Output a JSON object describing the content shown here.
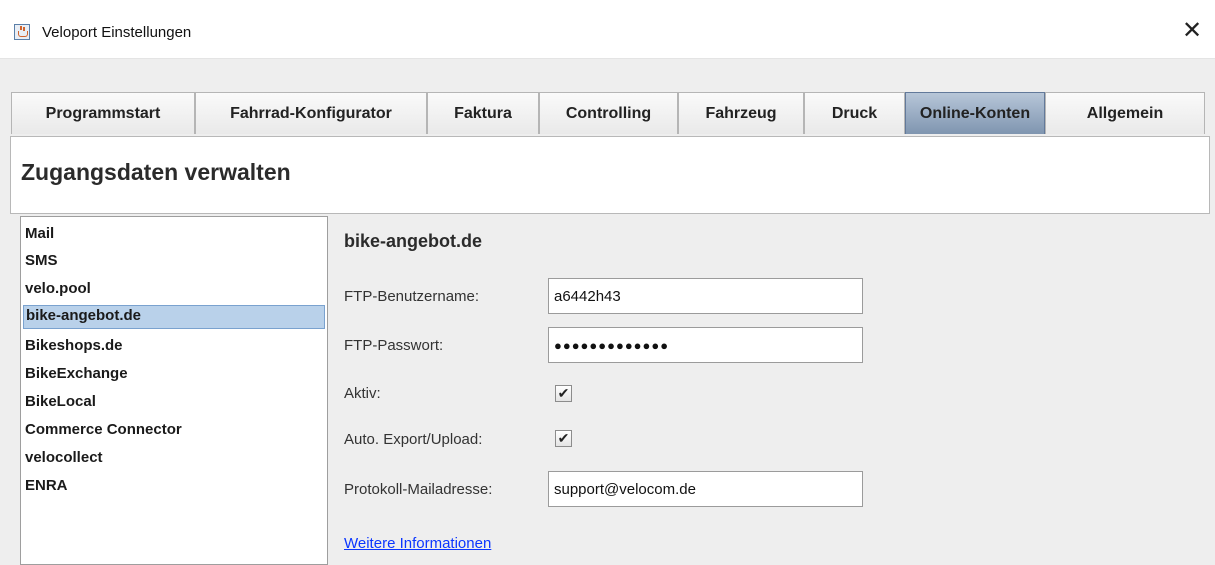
{
  "window": {
    "title": "Veloport Einstellungen",
    "close_glyph": "✕"
  },
  "tabs": [
    {
      "label": "Programmstart",
      "active": false
    },
    {
      "label": "Fahrrad-Konfigurator",
      "active": false
    },
    {
      "label": "Faktura",
      "active": false
    },
    {
      "label": "Controlling",
      "active": false
    },
    {
      "label": "Fahrzeug",
      "active": false
    },
    {
      "label": "Druck",
      "active": false
    },
    {
      "label": "Online-Konten",
      "active": true
    },
    {
      "label": "Allgemein",
      "active": false
    }
  ],
  "header": {
    "title": "Zugangsdaten verwalten"
  },
  "accounts": {
    "items": [
      "Mail",
      "SMS",
      "velo.pool",
      "bike-angebot.de",
      "Bikeshops.de",
      "BikeExchange",
      "BikeLocal",
      "Commerce Connector",
      "velocollect",
      "ENRA"
    ],
    "selected": "bike-angebot.de"
  },
  "detail": {
    "title": "bike-angebot.de",
    "ftp_user_label": "FTP-Benutzername:",
    "ftp_user_value": "a6442h43",
    "ftp_password_label": "FTP-Passwort:",
    "ftp_password_mask": "●●●●●●●●●●●●●",
    "active_label": "Aktiv:",
    "active_checked": true,
    "auto_export_label": "Auto. Export/Upload:",
    "auto_export_checked": true,
    "protocol_mail_label": "Protokoll-Mailadresse:",
    "protocol_mail_value": "support@velocom.de",
    "more_info_link": "Weitere Informationen",
    "check_glyph": "✔"
  },
  "colors": {
    "active_tab": "#8ea2bd",
    "selected_item": "#b9d1ea",
    "link": "#0b36ff"
  }
}
